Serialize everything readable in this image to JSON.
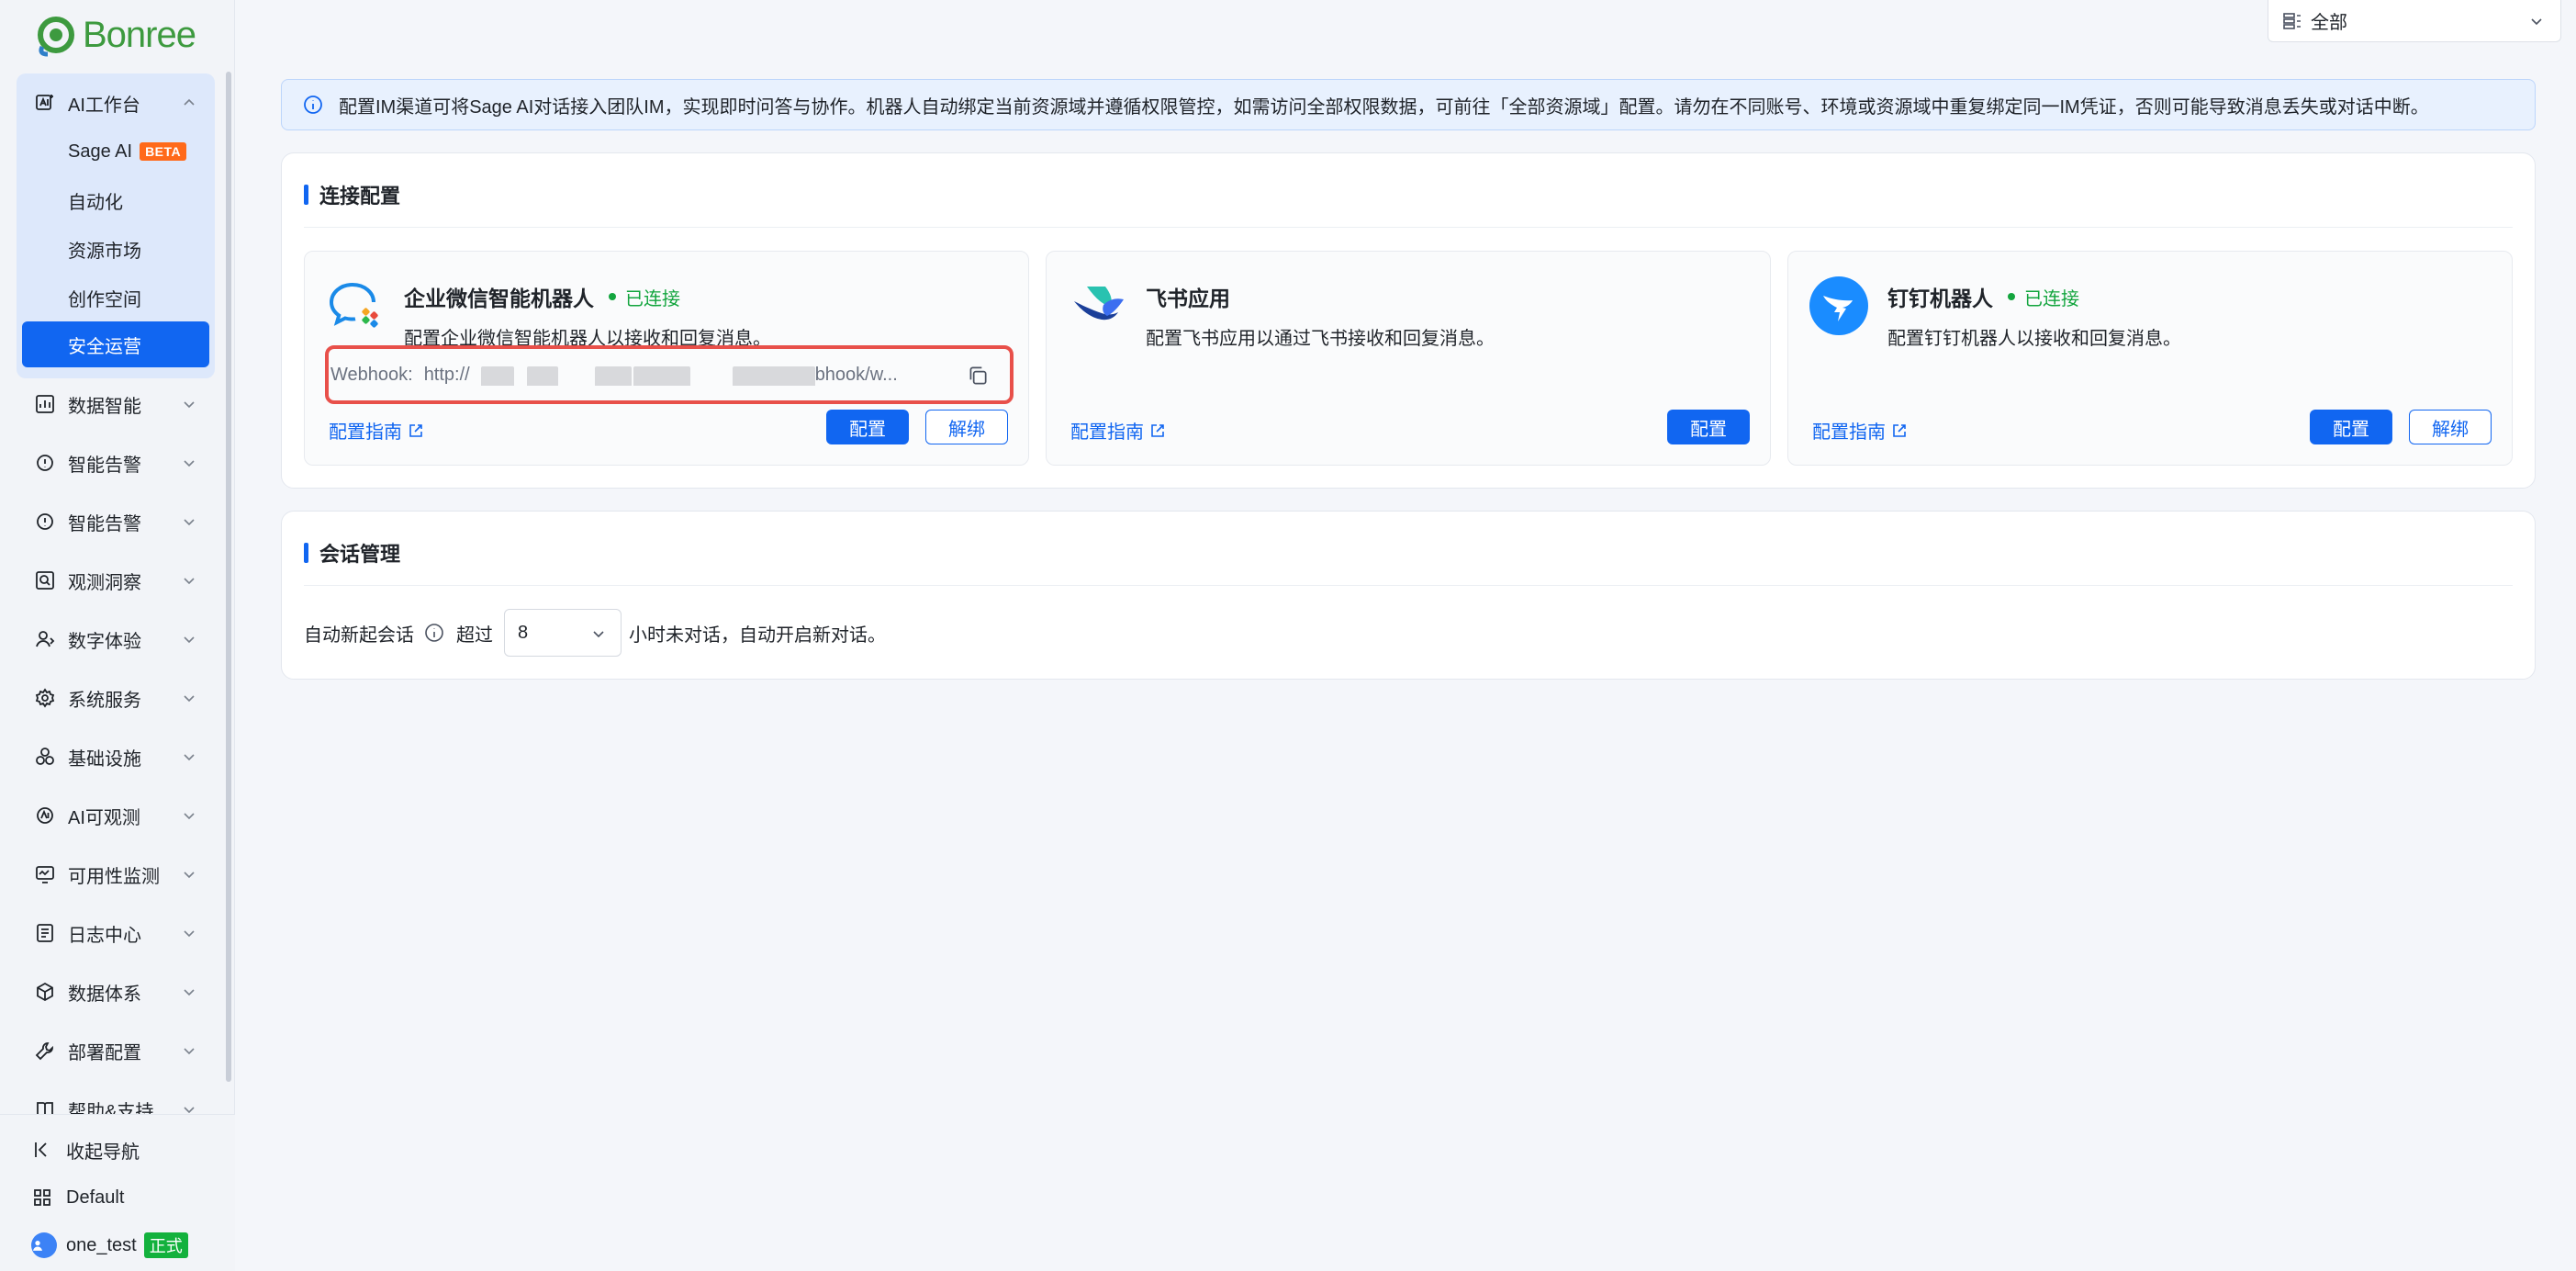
{
  "brand": {
    "name": "Bonree"
  },
  "sidebar": {
    "groups": [
      {
        "label": "AI工作台",
        "expanded": true,
        "children": [
          {
            "label": "Sage AI",
            "badge": "BETA"
          },
          {
            "label": "自动化"
          },
          {
            "label": "资源市场"
          },
          {
            "label": "创作空间"
          },
          {
            "label": "安全运营",
            "active": true
          }
        ]
      },
      {
        "label": "数据智能"
      },
      {
        "label": "智能告警"
      },
      {
        "label": "智能告警"
      },
      {
        "label": "观测洞察"
      },
      {
        "label": "数字体验"
      },
      {
        "label": "系统服务"
      },
      {
        "label": "基础设施"
      },
      {
        "label": "AI可观测"
      },
      {
        "label": "可用性监测"
      },
      {
        "label": "日志中心"
      },
      {
        "label": "数据体系"
      },
      {
        "label": "部署配置"
      },
      {
        "label": "帮助&支持"
      }
    ],
    "footer": {
      "collapse_label": "收起导航",
      "workspace_label": "Default",
      "user_name": "one_test",
      "env_badge": "正式"
    }
  },
  "topbar": {
    "scope_label": "全部"
  },
  "info_banner": {
    "text": "配置IM渠道可将Sage AI对话接入团队IM，实现即时问答与协作。机器人自动绑定当前资源域并遵循权限管控，如需访问全部权限数据，可前往「全部资源域」配置。请勿在不同账号、环境或资源域中重复绑定同一IM凭证，否则可能导致消息丢失或对话中断。"
  },
  "connection_panel": {
    "title": "连接配置",
    "cards": [
      {
        "name": "企业微信智能机器人",
        "status": "已连接",
        "description": "配置企业微信智能机器人以接收和回复消息。",
        "webhook_label": "Webhook:",
        "webhook_prefix": "http://",
        "webhook_suffix": "bhook/w...",
        "guide_label": "配置指南",
        "config_label": "配置",
        "unbind_label": "解绑"
      },
      {
        "name": "飞书应用",
        "description": "配置飞书应用以通过飞书接收和回复消息。",
        "guide_label": "配置指南",
        "config_label": "配置"
      },
      {
        "name": "钉钉机器人",
        "status": "已连接",
        "description": "配置钉钉机器人以接收和回复消息。",
        "guide_label": "配置指南",
        "config_label": "配置",
        "unbind_label": "解绑"
      }
    ]
  },
  "session_panel": {
    "title": "会话管理",
    "auto_label": "自动新起会话",
    "exceed_label": "超过",
    "hours_value": "8",
    "suffix_label": "小时未对话，自动开启新对话。"
  },
  "colors": {
    "primary": "#1166f1",
    "success": "#13a53e",
    "beta": "#ff6a1a",
    "highlight_border": "#e8504a"
  }
}
